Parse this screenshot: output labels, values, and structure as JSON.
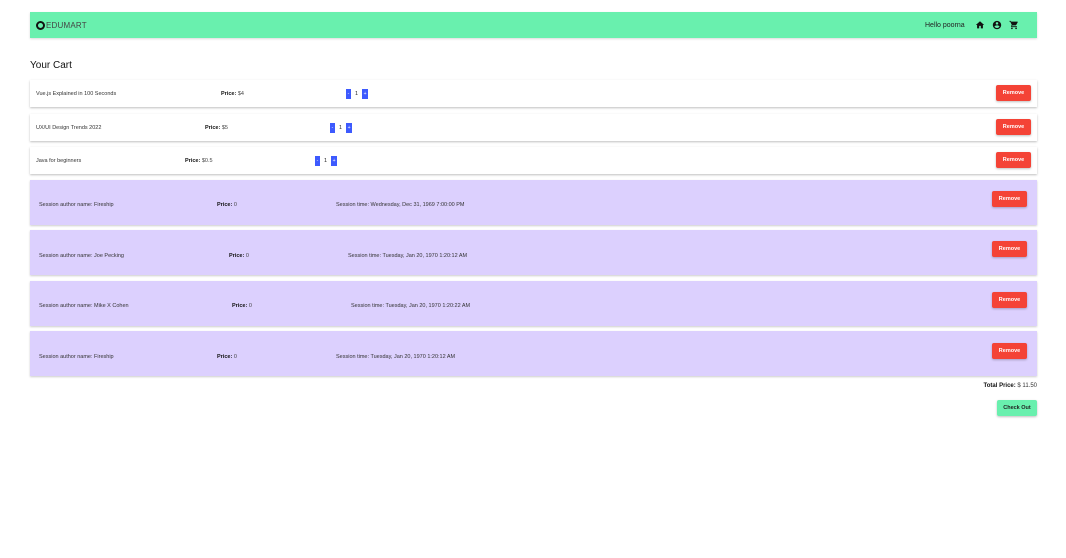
{
  "header": {
    "brand": "EDUMART",
    "greeting": "Hello poorna",
    "icons": [
      "home-icon",
      "account-icon",
      "cart-icon"
    ],
    "color": "#69f0ae"
  },
  "page_title": "Your Cart",
  "courses": [
    {
      "title": "Vue.js Explained in 100 Seconds",
      "price_label": "Price:",
      "price_value": "$4",
      "quantity": "1",
      "minus": "-",
      "plus": "+",
      "remove": "Remove"
    },
    {
      "title": "UX/UI Design Trends 2022",
      "price_label": "Price:",
      "price_value": "$5",
      "quantity": "1",
      "minus": "-",
      "plus": "+",
      "remove": "Remove"
    },
    {
      "title": "Java for beginners",
      "price_label": "Price:",
      "price_value": "$0.5",
      "quantity": "1",
      "minus": "-",
      "plus": "+",
      "remove": "Remove"
    }
  ],
  "sessions": [
    {
      "author": "Session author name: Fireship",
      "price_label": "Price:",
      "price_value": "0",
      "time": "Session time: Wednesday, Dec 31, 1969 7:00:00 PM",
      "remove": "Remove"
    },
    {
      "author": "Session author name: Joe Pecking",
      "price_label": "Price:",
      "price_value": "0",
      "time": "Session time: Tuesday, Jan 20, 1970 1:20:12 AM",
      "remove": "Remove"
    },
    {
      "author": "Session author name: Mike X Cohen",
      "price_label": "Price:",
      "price_value": "0",
      "time": "Session time: Tuesday, Jan 20, 1970 1:20:22 AM",
      "remove": "Remove"
    },
    {
      "author": "Session author name: Fireship",
      "price_label": "Price:",
      "price_value": "0",
      "time": "Session time: Tuesday, Jan 20, 1970 1:20:12 AM",
      "remove": "Remove"
    }
  ],
  "total": {
    "label": "Total Price:",
    "value": "$ 11.50"
  },
  "checkout_label": "Check Out",
  "colors": {
    "remove": "#f44336",
    "session_bg": "#dcd0fe",
    "qty": "#3d5afe",
    "checkout": "#69f0ae"
  }
}
